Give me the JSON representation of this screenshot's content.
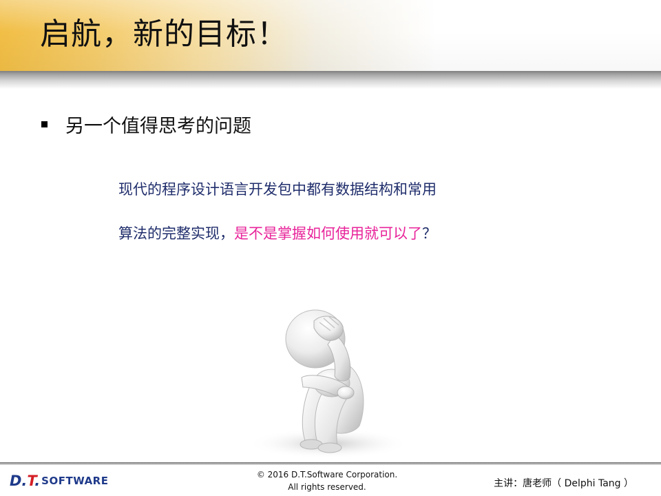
{
  "title": "启航，新的目标！",
  "bullet": "另一个值得思考的问题",
  "quote": {
    "line1": "现代的程序设计语言开发包中都有数据结构和常用",
    "line2_start": "算法的完整实现，",
    "line2_highlight": "是不是掌握如何使用就可以了",
    "line2_end": "？"
  },
  "colors": {
    "title_gold": "#f1be45",
    "quote_blue": "#1f2d6b",
    "highlight_pink": "#e8239a",
    "logo_blue": "#1f3a8a",
    "logo_red": "#d41f26"
  },
  "figure": {
    "icon": "thinking-person-icon"
  },
  "footer": {
    "logo_dt_prefix": "D.",
    "logo_dt_red": "T",
    "logo_dt_suffix": ".",
    "logo_software": "SOFTWARE",
    "copyright_line1": "© 2016 D.T.Software Corporation.",
    "copyright_line2": "All rights reserved.",
    "lecturer": "主讲：唐老师（ Delphi Tang ）"
  }
}
